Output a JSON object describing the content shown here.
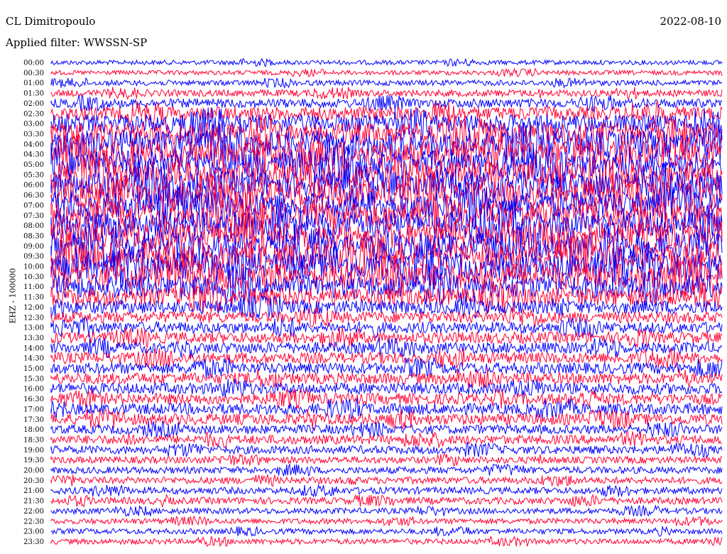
{
  "header": {
    "station": "CL Dimitropoulo",
    "filter": "Applied filter: WWSSN-SP",
    "date": "2022-08-10"
  },
  "chart_data": {
    "type": "line",
    "title": "CL Dimitropoulo",
    "subtitle": "Applied filter: WWSSN-SP",
    "ylabel": "EHZ - 100000",
    "trace_colors": [
      "#0000ff",
      "#ff0033"
    ],
    "tick_labels": [
      "00:00",
      "00:30",
      "01:00",
      "01:30",
      "02:00",
      "02:30",
      "03:00",
      "03:30",
      "04:00",
      "04:30",
      "05:00",
      "05:30",
      "06:00",
      "06:30",
      "07:00",
      "07:30",
      "08:00",
      "08:30",
      "09:00",
      "09:30",
      "10:00",
      "10:30",
      "11:00",
      "11:30",
      "12:00",
      "12:30",
      "13:00",
      "13:30",
      "14:00",
      "14:30",
      "15:00",
      "15:30",
      "16:00",
      "16:30",
      "17:00",
      "17:30",
      "18:00",
      "18:30",
      "19:00",
      "19:30",
      "20:00",
      "20:30",
      "21:00",
      "21:30",
      "22:00",
      "22:30",
      "23:00",
      "23:30"
    ],
    "relative_activity": [
      1,
      1,
      1.2,
      1.5,
      2,
      3,
      4,
      5,
      6,
      6,
      6,
      6,
      6,
      6,
      6,
      6,
      6,
      6,
      6,
      6,
      6,
      6,
      5,
      4,
      3,
      2.5,
      2.5,
      2.5,
      2.5,
      2.5,
      2.5,
      2.5,
      2.5,
      2.5,
      2.5,
      2.5,
      2,
      2,
      1.8,
      1.5,
      1.5,
      1.5,
      1.5,
      1.5,
      1.3,
      1.2,
      1.2,
      1.2
    ]
  }
}
